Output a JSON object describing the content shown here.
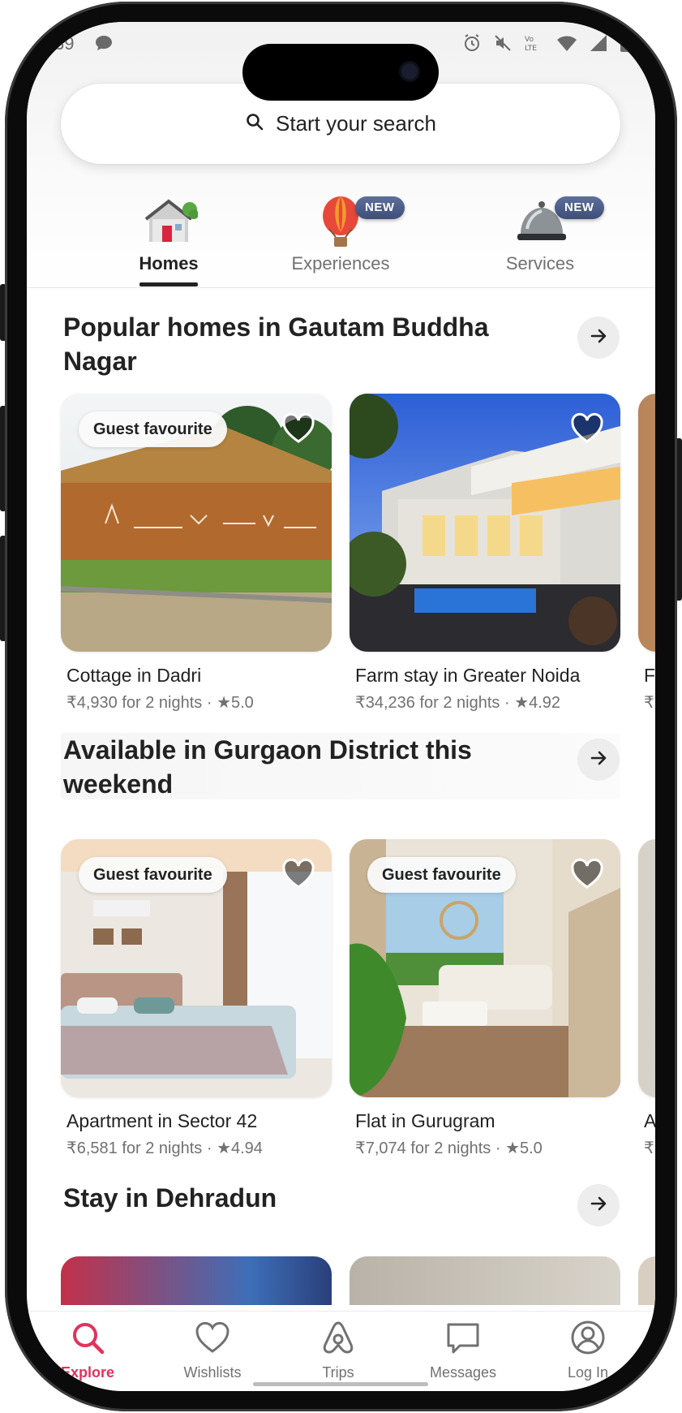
{
  "status_bar": {
    "time": "39"
  },
  "search": {
    "placeholder": "Start your search"
  },
  "categories": [
    {
      "label": "Homes",
      "active": true
    },
    {
      "label": "Experiences",
      "badge": "NEW"
    },
    {
      "label": "Services",
      "badge": "NEW"
    }
  ],
  "sections": [
    {
      "title": "Popular homes in Gautam Buddha Nagar",
      "cards": [
        {
          "badge": "Guest favourite",
          "title": "Cottage in Dadri",
          "price": "₹4,930 for 2 nights",
          "rating": "5.0"
        },
        {
          "title": "Farm stay in Greater Noida",
          "price": "₹34,236 for 2 nights",
          "rating": "4.92"
        },
        {
          "title": "F",
          "price": "₹"
        }
      ]
    },
    {
      "title": "Available in Gurgaon District this weekend",
      "cards": [
        {
          "badge": "Guest favourite",
          "title": "Apartment in Sector 42",
          "price": "₹6,581 for 2 nights",
          "rating": "4.94"
        },
        {
          "badge": "Guest favourite",
          "title": "Flat in Gurugram",
          "price": "₹7,074 for 2 nights",
          "rating": "5.0"
        },
        {
          "title": "A",
          "price": "₹"
        }
      ]
    },
    {
      "title": "Stay in Dehradun"
    }
  ],
  "tabbar": [
    {
      "label": "Explore",
      "icon": "search-icon",
      "active": true
    },
    {
      "label": "Wishlists",
      "icon": "heart-icon"
    },
    {
      "label": "Trips",
      "icon": "airbnb-logo-icon"
    },
    {
      "label": "Messages",
      "icon": "message-icon"
    },
    {
      "label": "Log In",
      "icon": "profile-icon"
    }
  ],
  "colors": {
    "accent": "#E0335B",
    "text": "#222222",
    "muted": "#717171",
    "badge": "#4A5A85"
  }
}
